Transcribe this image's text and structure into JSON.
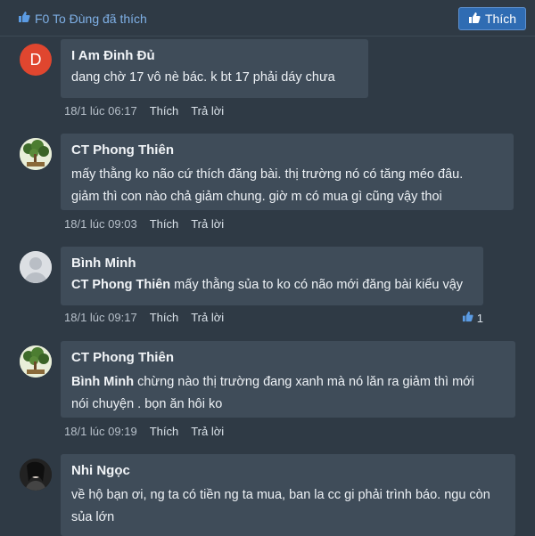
{
  "header": {
    "liked_by": "F0 To Đùng đã thích",
    "like_button": "Thích",
    "accent": "#2f6cb3"
  },
  "comments": [
    {
      "author": "I Am Đinh Đủ",
      "avatar_letter": "D",
      "avatar_color": "#e0462f",
      "mention": "",
      "text": "dang chờ 17 vô nè bác. k bt 17 phải dáy chưa",
      "time": "18/1 lúc 06:17",
      "like_action": "Thích",
      "reply_action": "Trả lời",
      "likes": ""
    },
    {
      "author": "CT Phong Thiên",
      "avatar_letter": "",
      "mention": "",
      "text_line1": "mấy thằng ko não cứ thích đăng bài. thị trường nó có tăng méo đâu.",
      "text_line2": "giảm thì con nào chả giảm chung. giờ m có mua gì cũng vậy thoi",
      "time": "18/1 lúc 09:03",
      "like_action": "Thích",
      "reply_action": "Trả lời",
      "likes": ""
    },
    {
      "author": "Bình Minh",
      "avatar_letter": "",
      "mention": "CT Phong Thiên",
      "text": " mấy thằng sủa to ko có não mới đăng bài kiểu vậy",
      "time": "18/1 lúc 09:17",
      "like_action": "Thích",
      "reply_action": "Trả lời",
      "likes": "1"
    },
    {
      "author": "CT Phong Thiên",
      "avatar_letter": "",
      "mention": "Bình Minh",
      "text_line1": " chừng nào thị trường đang xanh mà nó lăn ra giảm thì mới",
      "text_line2": "nói chuyện . bọn ăn hôi ko",
      "time": "18/1 lúc 09:19",
      "like_action": "Thích",
      "reply_action": "Trả lời",
      "likes": ""
    },
    {
      "author": "Nhi Ngọc",
      "avatar_letter": "",
      "mention": "",
      "text_line1": "về hộ bạn ơi, ng ta có tiền ng ta mua, ban la cc gi phải trình báo. ngu còn",
      "text_line2": "sủa lớn",
      "time": "",
      "like_action": "",
      "reply_action": "",
      "likes": ""
    }
  ]
}
